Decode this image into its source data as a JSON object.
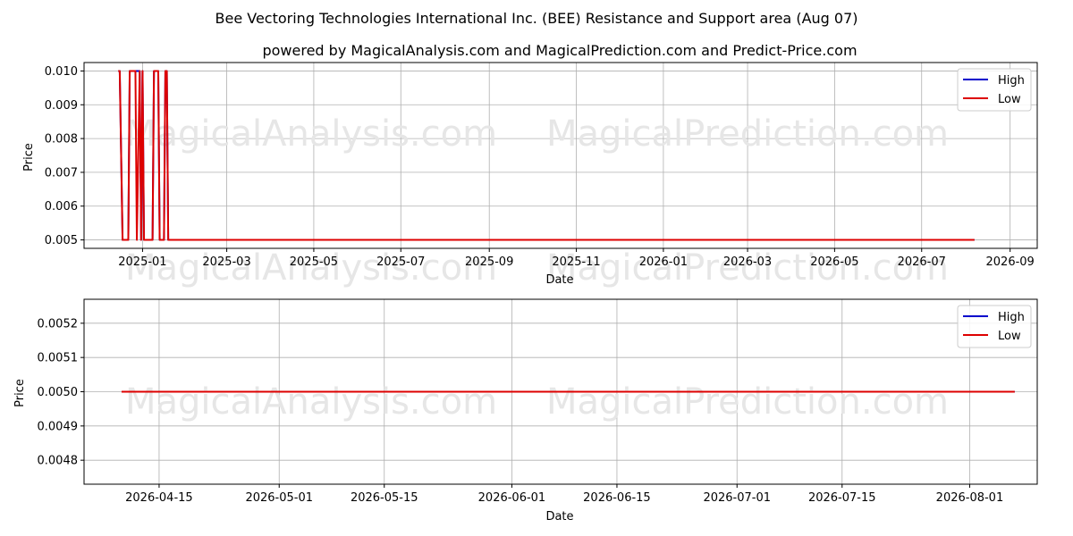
{
  "figure": {
    "title": "Bee Vectoring Technologies International Inc. (BEE) Resistance and Support area (Aug 07)",
    "subtitle": "powered by MagicalAnalysis.com and MagicalPrediction.com and Predict-Price.com",
    "watermarks": [
      "MagicalAnalysis.com",
      "MagicalPrediction.com"
    ]
  },
  "colors": {
    "high": "#0000cc",
    "low": "#dd0000",
    "grid": "#b0b0b0",
    "watermark": "#e6e6e6"
  },
  "chart_data": [
    {
      "type": "line",
      "xlabel": "Date",
      "ylabel": "Price",
      "x_ticks": [
        "2025-01",
        "2025-03",
        "2025-05",
        "2025-07",
        "2025-09",
        "2025-11",
        "2026-01",
        "2026-03",
        "2026-05",
        "2026-07",
        "2026-09"
      ],
      "y_ticks": [
        "0.005",
        "0.006",
        "0.007",
        "0.008",
        "0.009",
        "0.010"
      ],
      "ylim": [
        0.00475,
        0.01025
      ],
      "xlim": [
        "2024-11-21",
        "2026-09-20"
      ],
      "grid": true,
      "legend": "top-right",
      "series": [
        {
          "name": "High",
          "x": [
            "2024-12-15",
            "2024-12-16",
            "2024-12-18",
            "2024-12-22",
            "2024-12-23",
            "2024-12-30",
            "2024-12-31",
            "2025-01-01",
            "2025-01-02",
            "2025-01-03",
            "2025-01-08",
            "2025-01-09",
            "2025-01-12",
            "2025-01-13",
            "2025-01-16",
            "2025-01-17",
            "2025-01-18",
            "2025-01-19",
            "2025-01-20",
            "2026-08-07"
          ],
          "values": [
            0.01,
            0.01,
            0.005,
            0.005,
            0.01,
            0.01,
            0.005,
            0.01,
            0.005,
            0.005,
            0.005,
            0.01,
            0.01,
            0.005,
            0.005,
            0.01,
            0.01,
            0.005,
            0.005,
            0.005
          ]
        },
        {
          "name": "Low",
          "x": [
            "2024-12-15",
            "2024-12-16",
            "2024-12-18",
            "2024-12-22",
            "2024-12-23",
            "2024-12-27",
            "2024-12-28",
            "2024-12-30",
            "2024-12-31",
            "2025-01-01",
            "2025-01-02",
            "2025-01-03",
            "2025-01-08",
            "2025-01-09",
            "2025-01-12",
            "2025-01-13",
            "2025-01-16",
            "2025-01-17",
            "2025-01-18",
            "2025-01-19",
            "2025-01-20",
            "2026-08-07"
          ],
          "values": [
            0.01,
            0.01,
            0.005,
            0.005,
            0.01,
            0.01,
            0.005,
            0.01,
            0.005,
            0.01,
            0.005,
            0.005,
            0.005,
            0.01,
            0.01,
            0.005,
            0.005,
            0.01,
            0.01,
            0.005,
            0.005,
            0.005
          ]
        }
      ]
    },
    {
      "type": "line",
      "xlabel": "Date",
      "ylabel": "Price",
      "x_ticks": [
        "2026-04-15",
        "2026-05-01",
        "2026-05-15",
        "2026-06-01",
        "2026-06-15",
        "2026-07-01",
        "2026-07-15",
        "2026-08-01"
      ],
      "y_ticks": [
        "0.0048",
        "0.0049",
        "0.0050",
        "0.0051",
        "0.0052"
      ],
      "ylim": [
        0.00473,
        0.00527
      ],
      "xlim": [
        "2026-04-05",
        "2026-08-10"
      ],
      "grid": true,
      "legend": "top-right",
      "series": [
        {
          "name": "High",
          "x": [
            "2026-04-10",
            "2026-08-07"
          ],
          "values": [
            0.005,
            0.005
          ]
        },
        {
          "name": "Low",
          "x": [
            "2026-04-10",
            "2026-08-07"
          ],
          "values": [
            0.005,
            0.005
          ]
        }
      ]
    }
  ]
}
